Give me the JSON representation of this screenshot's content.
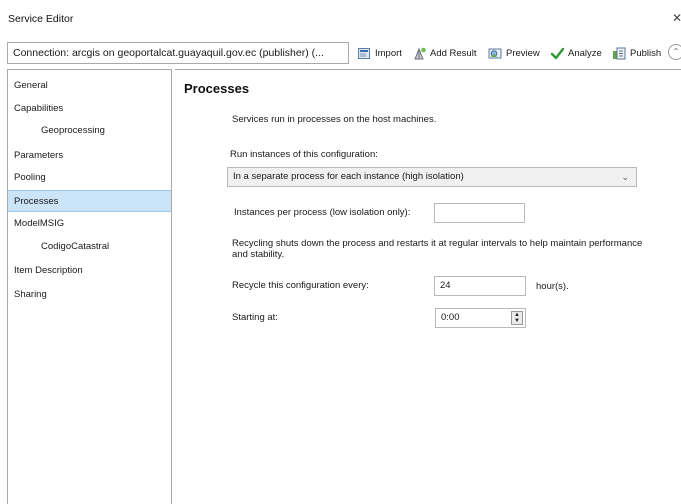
{
  "window": {
    "title": "Service Editor",
    "close_glyph": "✕"
  },
  "toolbar": {
    "connection": "Connection: arcgis on geoportalcat.guayaquil.gov.ec (publisher) (...",
    "import_label": "Import",
    "add_result_label": "Add Result",
    "preview_label": "Preview",
    "analyze_label": "Analyze",
    "publish_label": "Publish",
    "collapse_glyph": "⌃"
  },
  "sidebar": {
    "items": [
      {
        "label": "General"
      },
      {
        "label": "Capabilities"
      },
      {
        "label": "Geoprocessing"
      },
      {
        "label": "Parameters"
      },
      {
        "label": "Pooling"
      },
      {
        "label": "Processes"
      },
      {
        "label": "ModelMSIG"
      },
      {
        "label": "CodigoCatastral"
      },
      {
        "label": "Item Description"
      },
      {
        "label": "Sharing"
      }
    ],
    "selected": "Processes"
  },
  "main": {
    "title": "Processes",
    "intro": "Services run in processes on the host machines.",
    "run_instances_label": "Run instances of this configuration:",
    "run_instances_value": "In a separate process for each instance (high isolation)",
    "instances_label": "Instances per process (low isolation only):",
    "instances_value": "",
    "recycling_note": "Recycling shuts down the process and restarts it at regular intervals to help maintain performance and stability.",
    "recycle_label": "Recycle this configuration every:",
    "recycle_value": "24",
    "recycle_unit": "hour(s).",
    "starting_label": "Starting at:",
    "starting_value": "0:00"
  }
}
